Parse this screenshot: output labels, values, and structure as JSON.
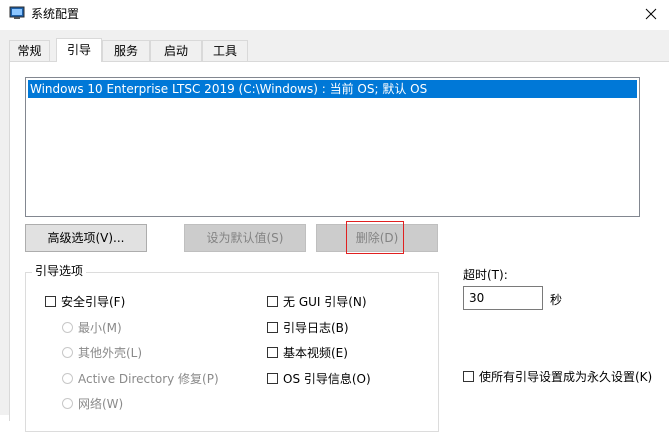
{
  "window": {
    "title": "系统配置"
  },
  "tabs": [
    {
      "label": "常规"
    },
    {
      "label": "引导"
    },
    {
      "label": "服务"
    },
    {
      "label": "启动"
    },
    {
      "label": "工具"
    }
  ],
  "os_list": {
    "items": [
      {
        "label": "Windows 10 Enterprise LTSC 2019 (C:\\Windows) : 当前 OS; 默认 OS"
      }
    ]
  },
  "buttons": {
    "advanced": "高级选项(V)...",
    "set_default": "设为默认值(S)",
    "delete": "删除(D)"
  },
  "boot_options": {
    "group_label": "引导选项",
    "safe_boot": "安全引导(F)",
    "minimal": "最小(M)",
    "alternate_shell": "其他外壳(L)",
    "ad_repair": "Active Directory 修复(P)",
    "network": "网络(W)",
    "no_gui_boot": "无 GUI 引导(N)",
    "boot_log": "引导日志(B)",
    "base_video": "基本视频(E)",
    "os_boot_info": "OS 引导信息(O)"
  },
  "timeout": {
    "label": "超时(T):",
    "value": "30",
    "unit": "秒"
  },
  "permanent": {
    "label": "使所有引导设置成为永久设置(K)"
  },
  "colors": {
    "selection": "#0078d7",
    "highlight_border": "#e02020"
  }
}
